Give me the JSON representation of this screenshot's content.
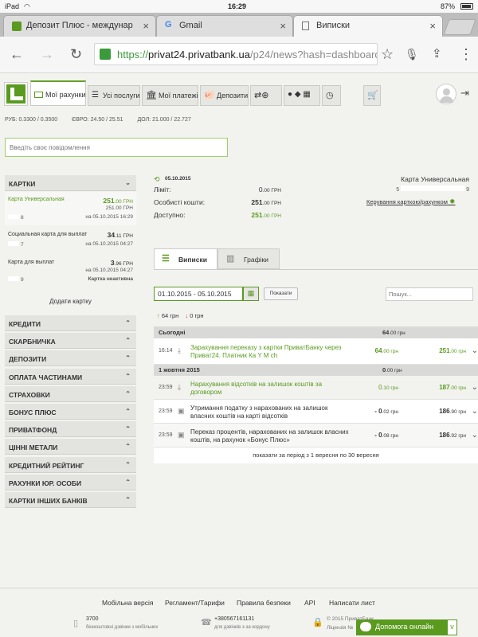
{
  "status_bar": {
    "device": "iPad",
    "wifi": "wifi-icon",
    "time": "16:29",
    "battery": "87%"
  },
  "browser": {
    "tabs": [
      {
        "label": "Депозит Плюс - междунар"
      },
      {
        "label": "Gmail"
      },
      {
        "label": "Виписки"
      }
    ],
    "url": {
      "https": "https://",
      "domain": "privat24.privatbank.ua",
      "path": "/p24/news?hash=dashboard"
    }
  },
  "nav": {
    "items": [
      {
        "label": "Мої рахунки"
      },
      {
        "label": "Усі послуги"
      },
      {
        "label": "Мої платежі"
      },
      {
        "label": "Депозити"
      }
    ]
  },
  "rates": {
    "usd_label": "РУБ:",
    "usd_value": "0.3300 / 0.3500",
    "eur_label": "ЄВРО:",
    "eur_value": "24.50 / 25.51",
    "dol_label": "ДОЛ:",
    "dol_value": "21.000 / 22.727"
  },
  "message_input": {
    "placeholder": "Введіть своє повідомлення"
  },
  "sidebar": {
    "cards_header": "КАРТКИ",
    "cards": [
      {
        "name": "Карта Универсальная",
        "amount_int": "251",
        "amount_dec": ".00 ГРН",
        "sub": "251.00 ГРН",
        "num": "8",
        "date": "на 05.10.2015 16:29"
      },
      {
        "name": "Социальная карта для выплат",
        "amount_int": "34",
        "amount_dec": ".11 ГРН",
        "num": "7",
        "date": "на 05.10.2015 04:27"
      },
      {
        "name": "Карта для выплат",
        "amount_int": "3",
        "amount_dec": ".96 ГРН",
        "num": "9",
        "date": "на 05.10.2015 04:27",
        "status": "Картка неактивна"
      }
    ],
    "add_card": "Додати картку",
    "sections": [
      "КРЕДИТИ",
      "СКАРБНИЧКА",
      "ДЕПОЗИТИ",
      "ОПЛАТА ЧАСТИНАМИ",
      "СТРАХОВКИ",
      "БОНУС ПЛЮС",
      "ПРИВАТФОНД",
      "ЦІННІ МЕТАЛИ",
      "КРЕДИТНИЙ РЕЙТИНГ",
      "РАХУНКИ ЮР. ОСОБИ",
      "КАРТКИ ІНШИХ БАНКІВ"
    ]
  },
  "summary": {
    "date": "05.10.2015",
    "limit_label": "Ліміт:",
    "limit_int": "0",
    "limit_dec": ".00 ГРН",
    "own_label": "Особисті кошти:",
    "own_int": "251",
    "own_dec": ".00 ГРН",
    "avail_label": "Доступно:",
    "avail_int": "251",
    "avail_dec": ".00 ГРН",
    "card_name": "Карта Универсальная",
    "card_num_prefix": "5",
    "card_num_suffix": "9",
    "manage_link": "Керування карткою/рахунком"
  },
  "content_tabs": [
    {
      "label": "Виписки"
    },
    {
      "label": "Графіки"
    }
  ],
  "filter": {
    "date_range": "01.10.2015 - 05.10.2015",
    "show_button": "Показати",
    "search_placeholder": "Пошук..."
  },
  "totals": {
    "income": "64 грн",
    "expense": "0 грн"
  },
  "statement": {
    "groups": [
      {
        "label": "Сьогодні",
        "total": "64",
        "total_unit": ".00 грн"
      },
      {
        "label": "1 жовтня 2015",
        "total": "0",
        "total_unit": ".00 грн"
      }
    ],
    "rows": [
      {
        "time": "16:14",
        "desc1": "Зарахування переказу з картки ПриватБанку через",
        "desc2": "Приват24. Платник Ка       Y       M          ch",
        "amt_int": "64",
        "amt_dec": ".00 грн",
        "bal_int": "251",
        "bal_dec": ".00 грн"
      },
      {
        "time": "23:59",
        "desc1": "Нарахування відсотків на залишок коштів за",
        "desc2": "договором",
        "amt_int": "0",
        "amt_dec": ".10 грн",
        "bal_int": "187",
        "bal_dec": ".00 грн"
      },
      {
        "time": "23:59",
        "desc1": "Утримання податку з нарахованих на залишок",
        "desc2": "власних коштів на карті відсотків",
        "amt_int": "- 0",
        "amt_dec": ".02 грн",
        "bal_int": "186",
        "bal_dec": ".90 грн"
      },
      {
        "time": "23:59",
        "desc1": "Переказ процентів, нарахованих на залишок власних",
        "desc2": "коштів, на рахунок «Бонус Плюс»",
        "amt_int": "- 0",
        "amt_dec": ".08 грн",
        "bal_int": "186",
        "bal_dec": ".92 грн"
      }
    ],
    "period_note": "показати за період з 1 вересня по 30 вересня"
  },
  "footer": {
    "links": [
      "Мобільна версія",
      "Регламент/Тарифи",
      "Правила безпеки",
      "API",
      "Написати лист"
    ],
    "phone1": "3700",
    "phone1_note": "безкоштовні дзвінки з мобільних",
    "phone2": "+380567161131",
    "phone2_note": "для дзвінків з-за кордону",
    "copyright": "© 2015 ПриватБанк",
    "license": "Ліцензія №",
    "help_button": "Допомога онлайн"
  },
  "colors": {
    "brand_green": "#5a9a1f",
    "accent_bar": "#68a02c"
  }
}
